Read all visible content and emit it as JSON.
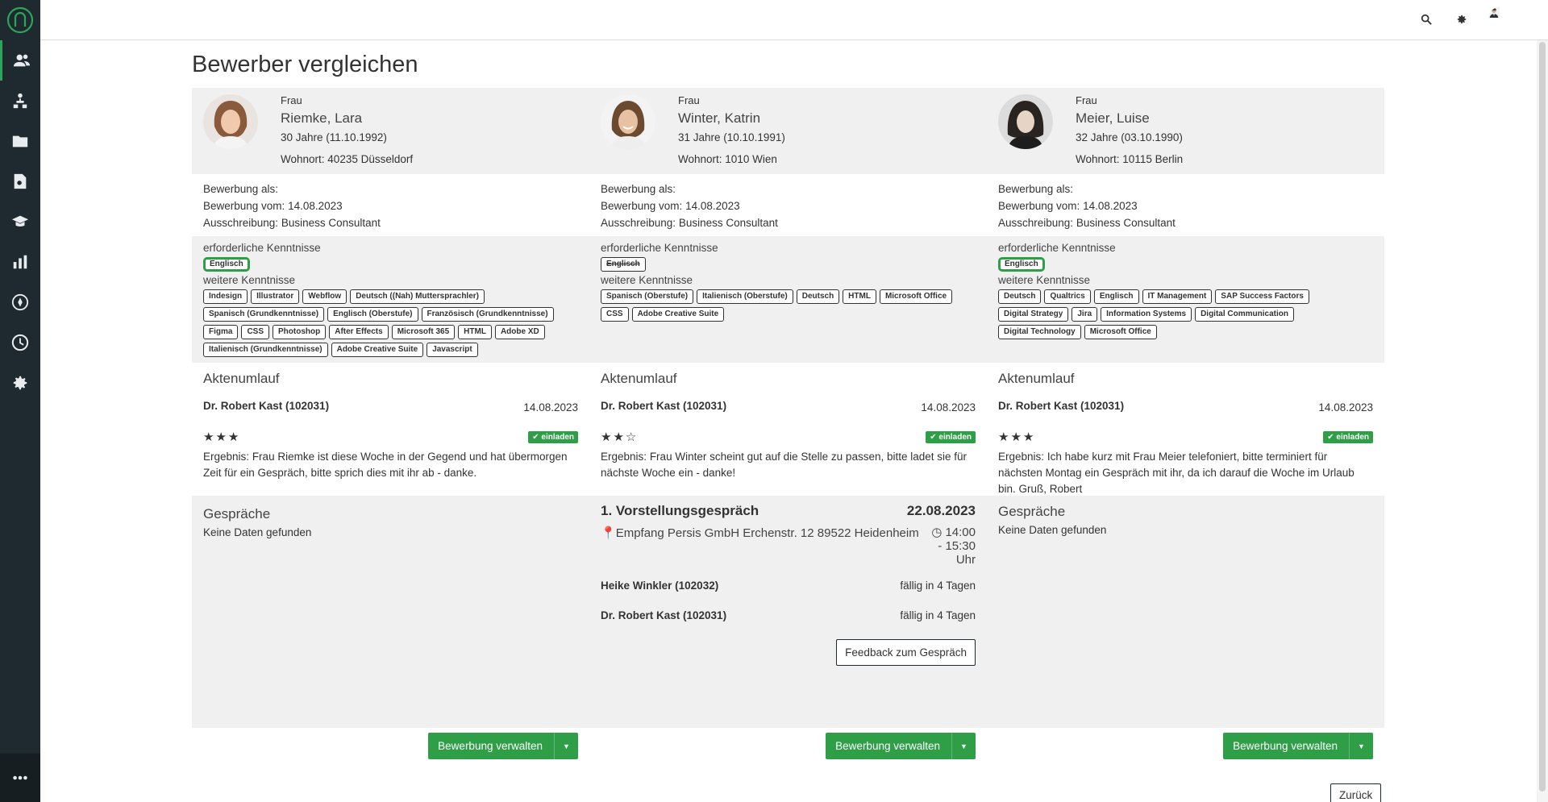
{
  "page": {
    "title": "Bewerber vergleichen"
  },
  "sidebar": {
    "items": [
      {
        "icon": "users-icon"
      },
      {
        "icon": "org-chart-icon"
      },
      {
        "icon": "folder-icon"
      },
      {
        "icon": "document-search-icon"
      },
      {
        "icon": "graduation-cap-icon"
      },
      {
        "icon": "chart-icon"
      },
      {
        "icon": "compass-icon"
      },
      {
        "icon": "clock-icon"
      },
      {
        "icon": "gear-icon"
      }
    ],
    "more_icon": "more-icon"
  },
  "topbar": {
    "icons": [
      "search-icon",
      "gear-icon",
      "user-avatar"
    ]
  },
  "labels": {
    "applied_as": "Bewerbung als:",
    "applied_on": "Bewerbung vom:",
    "posting": "Ausschreibung:",
    "required_skills": "erforderliche Kenntnisse",
    "other_skills": "weitere Kenntnisse",
    "file_history": "Aktenumlauf",
    "invite": "einladen",
    "result": "Ergebnis:",
    "residence": "Wohnort:",
    "interviews": "Gespräche",
    "no_data": "Keine Daten gefunden",
    "manage": "Bewerbung verwalten",
    "back": "Zurück",
    "feedback": "Feedback zum Gespräch"
  },
  "candidates": [
    {
      "salutation": "Frau",
      "name": "Riemke, Lara",
      "age": "30 Jahre (11.10.1992)",
      "residence": "40235 Düsseldorf",
      "applied_on": "14.08.2023",
      "posting": "Business Consultant",
      "required_skills": [
        {
          "label": "Englisch",
          "met": true
        }
      ],
      "other_skills": [
        "Indesign",
        "Illustrator",
        "Webflow",
        "Deutsch ((Nah) Muttersprachler)",
        "Spanisch (Grundkenntnisse)",
        "Englisch (Oberstufe)",
        "Französisch (Grundkenntnisse)",
        "Figma",
        "CSS",
        "Photoshop",
        "After Effects",
        "Microsoft 365",
        "HTML",
        "Adobe XD",
        "Italienisch (Grundkenntnisse)",
        "Adobe Creative Suite",
        "Javascript"
      ],
      "review": {
        "reviewer": "Dr. Robert Kast (102031)",
        "date": "14.08.2023",
        "stars": "★★★",
        "text": "Frau Riemke ist diese Woche in der Gegend und hat übermorgen Zeit für ein Gespräch, bitte sprich dies mit ihr ab - danke."
      }
    },
    {
      "salutation": "Frau",
      "name": "Winter, Katrin",
      "age": "31 Jahre (10.10.1991)",
      "residence": "1010 Wien",
      "applied_on": "14.08.2023",
      "posting": "Business Consultant",
      "required_skills": [
        {
          "label": "Englisch",
          "met": false
        }
      ],
      "other_skills": [
        "Spanisch (Oberstufe)",
        "Italienisch (Oberstufe)",
        "Deutsch",
        "HTML",
        "Microsoft Office",
        "CSS",
        "Adobe Creative Suite"
      ],
      "review": {
        "reviewer": "Dr. Robert Kast (102031)",
        "date": "14.08.2023",
        "stars": "★★☆",
        "text": "Frau Winter scheint gut auf die Stelle zu passen, bitte ladet sie für nächste Woche ein - danke!"
      },
      "interview": {
        "title": "1. Vorstellungsgespräch",
        "date": "22.08.2023",
        "location": "Empfang Persis GmbH Erchenstr. 12 89522 Heidenheim",
        "time_line1": "14:00",
        "time_line2": "- 15:30",
        "time_line3": "Uhr",
        "participants": [
          {
            "name": "Heike Winkler (102032)",
            "due": "fällig in 4 Tagen"
          },
          {
            "name": "Dr. Robert Kast (102031)",
            "due": "fällig in 4 Tagen"
          }
        ]
      }
    },
    {
      "salutation": "Frau",
      "name": "Meier, Luise",
      "age": "32 Jahre (03.10.1990)",
      "residence": "10115 Berlin",
      "applied_on": "14.08.2023",
      "posting": "Business Consultant",
      "required_skills": [
        {
          "label": "Englisch",
          "met": true
        }
      ],
      "other_skills": [
        "Deutsch",
        "Qualtrics",
        "Englisch",
        "IT Management",
        "SAP Success Factors",
        "Digital Strategy",
        "Jira",
        "Information Systems",
        "Digital Communication",
        "Digital Technology",
        "Microsoft Office"
      ],
      "review": {
        "reviewer": "Dr. Robert Kast (102031)",
        "date": "14.08.2023",
        "stars": "★★★",
        "text": "Ich habe kurz mit Frau Meier telefoniert, bitte terminiert für nächsten Montag ein Gespräch mit ihr, da ich darauf die Woche im Urlaub bin. Gruß, Robert"
      }
    }
  ]
}
